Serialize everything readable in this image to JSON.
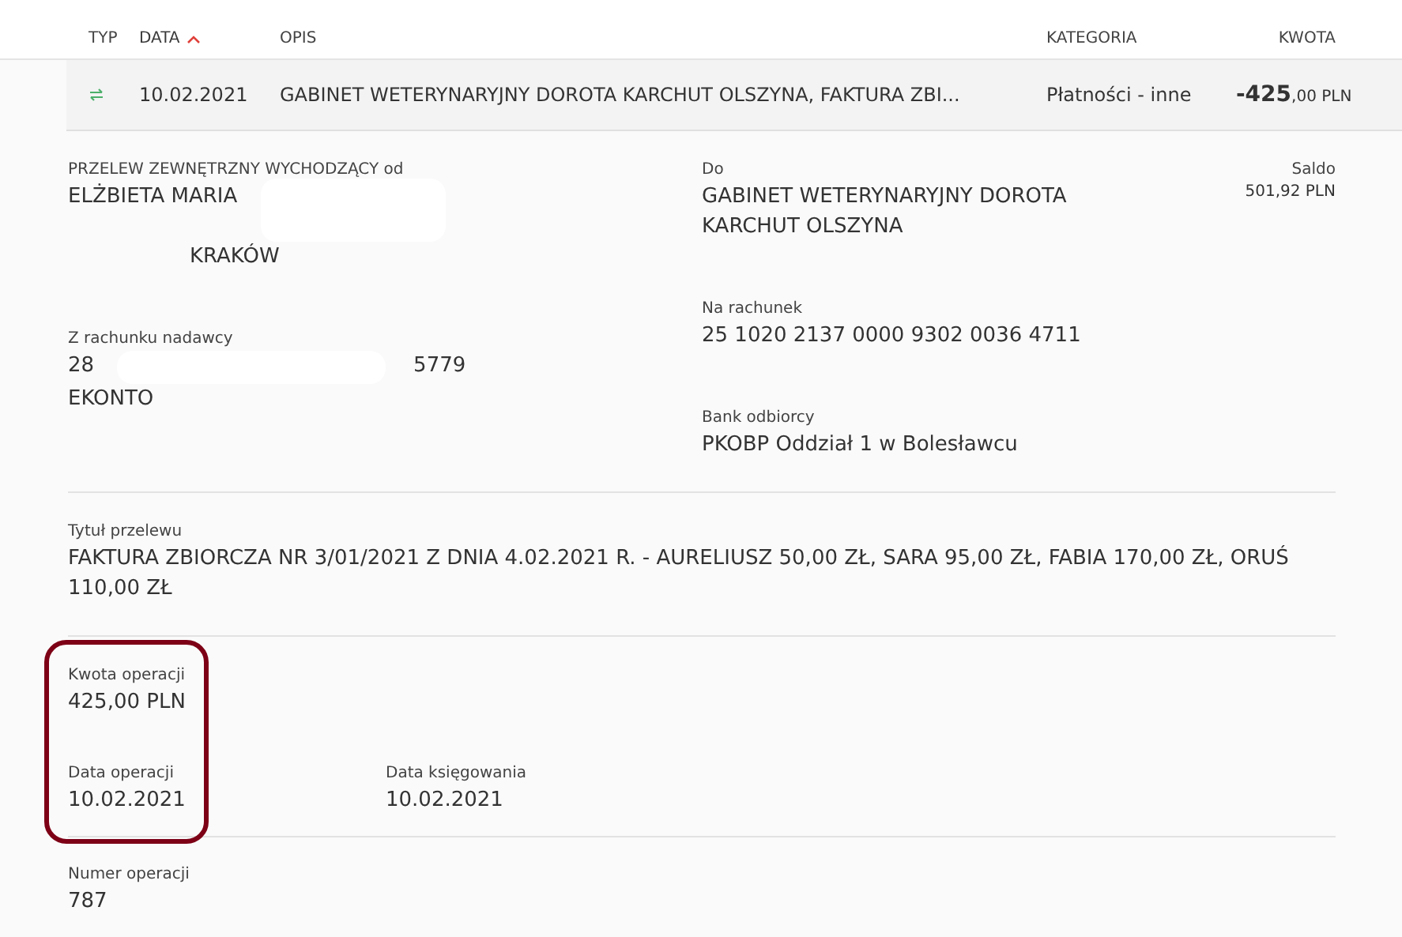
{
  "table": {
    "columns": [
      {
        "label": "TYP",
        "sorted": false
      },
      {
        "label": "DATA",
        "sorted": true
      },
      {
        "label": "OPIS",
        "sorted": false
      },
      {
        "label": "KATEGORIA",
        "sorted": false
      },
      {
        "label": "KWOTA",
        "sorted": false
      }
    ],
    "rows": [
      {
        "kind": "transfer",
        "date": "10.02.2021",
        "description": "GABINET WETERYNARYJNY DOROTA KARCHUT OLSZYNA, FAKTURA ZBI...",
        "category": "Płatności - inne",
        "amount_whole": "-425",
        "amount_fraction": ",00",
        "currency": "PLN",
        "expanded": true
      }
    ]
  },
  "details": {
    "sender": {
      "label": "PRZELEW ZEWNĘTRZNY WYCHODZĄCY od",
      "name": "ELŻBIETA MARIA",
      "city": "KRAKÓW"
    },
    "sender_account": {
      "label": "Z rachunku nadawcy",
      "prefix": "28",
      "suffix": "5779",
      "name": "EKONTO"
    },
    "recipient": {
      "label": "Do",
      "lines": [
        "GABINET WETERYNARYJNY DOROTA",
        "KARCHUT OLSZYNA"
      ]
    },
    "recipient_account": {
      "label": "Na rachunek",
      "value": "25 1020 2137 0000 9302 0036 4711"
    },
    "recipient_bank": {
      "label": "Bank odbiorcy",
      "value": "PKOBP Oddział 1 w Bolesławcu"
    },
    "balance": {
      "label": "Saldo",
      "value": "501,92 PLN"
    },
    "title": {
      "label": "Tytuł przelewu",
      "value": "FAKTURA ZBIORCZA NR 3/01/2021 Z DNIA 4.02.2021 R. - AURELIUSZ 50,00 ZŁ, SARA 95,00 ZŁ, FABIA 170,00 ZŁ, ORUŚ 110,00 ZŁ"
    },
    "amount": {
      "label": "Kwota operacji",
      "value": "425,00 PLN"
    },
    "operation_date": {
      "label": "Data operacji",
      "value": "10.02.2021"
    },
    "booking_date": {
      "label": "Data księgowania",
      "value": "10.02.2021"
    },
    "operation_number": {
      "label": "Numer operacji",
      "value": "787"
    }
  }
}
